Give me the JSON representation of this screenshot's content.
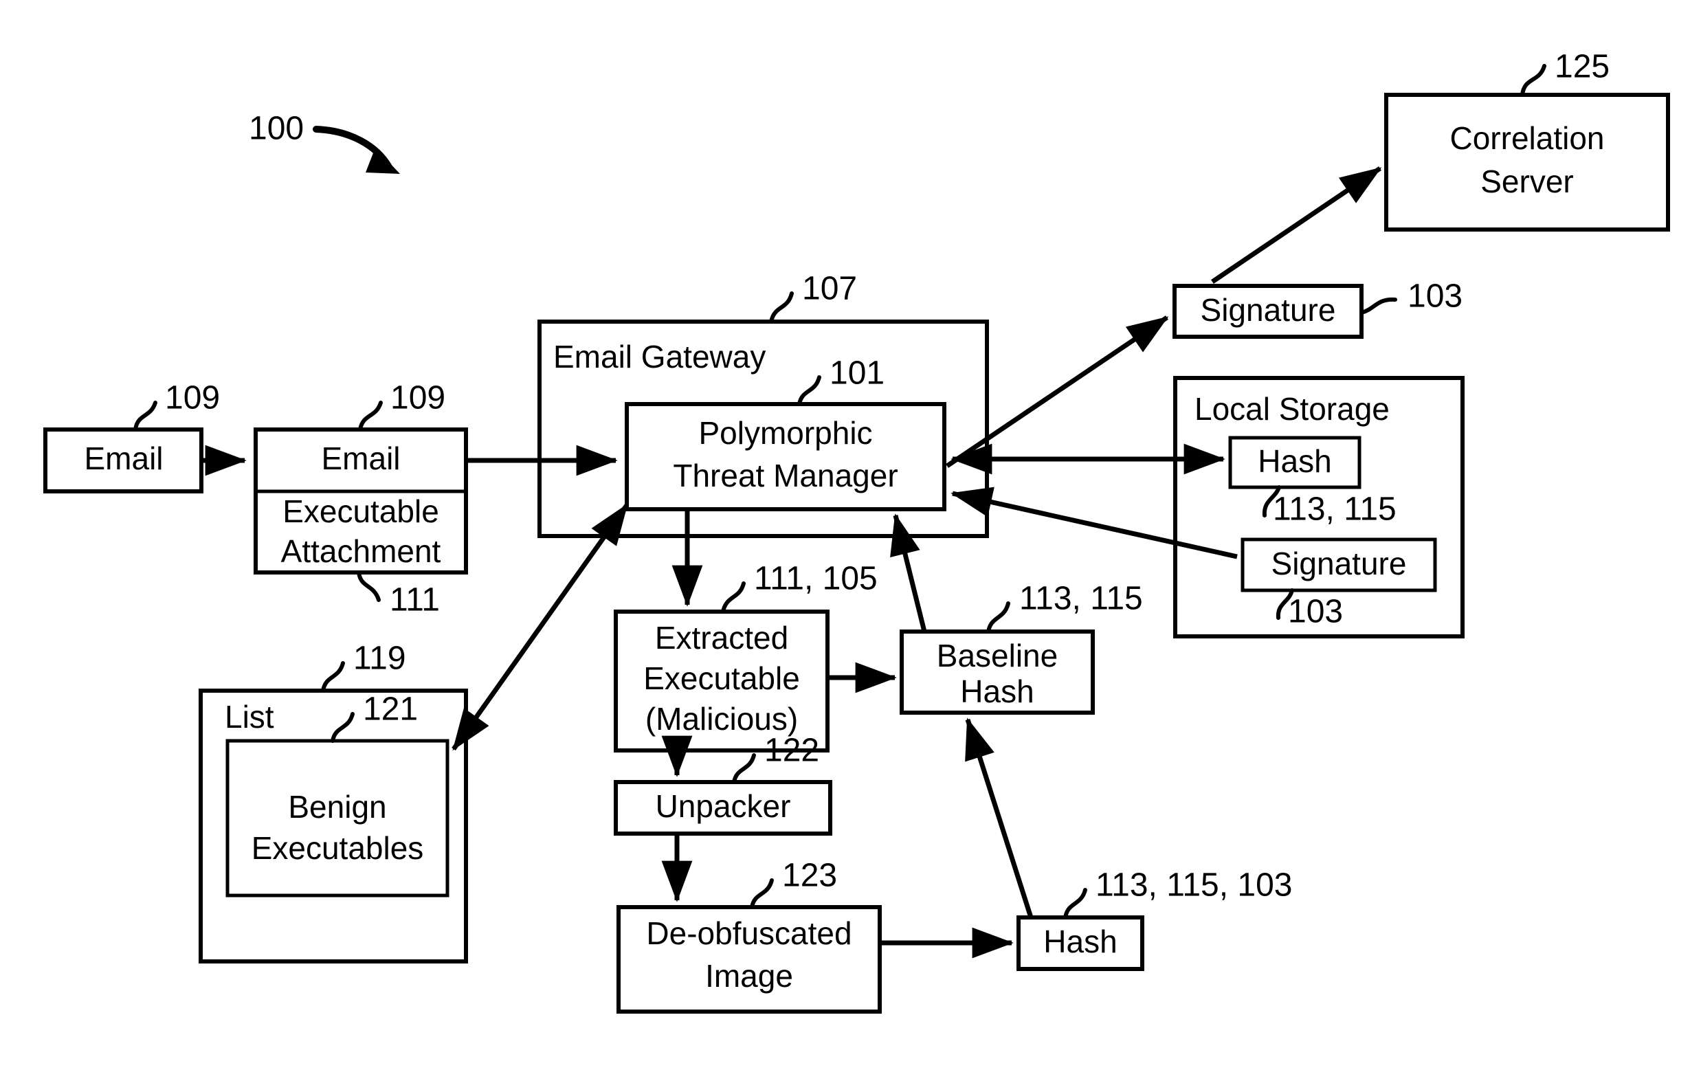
{
  "figure": {
    "number": "100",
    "type": "patent-block-diagram"
  },
  "boxes": {
    "email_source": {
      "label": "Email",
      "ref": "109"
    },
    "email_with_attachment": {
      "label_top": "Email",
      "label_bottom_line1": "Executable",
      "label_bottom_line2": "Attachment",
      "ref_top": "109",
      "ref_bottom": "111"
    },
    "email_gateway": {
      "label": "Email Gateway",
      "ref": "107"
    },
    "polymorphic_threat_manager": {
      "label_line1": "Polymorphic",
      "label_line2": "Threat Manager",
      "ref": "101"
    },
    "correlation_server": {
      "label_line1": "Correlation",
      "label_line2": "Server",
      "ref": "125"
    },
    "signature_out": {
      "label": "Signature",
      "ref": "103"
    },
    "local_storage": {
      "label": "Local Storage"
    },
    "local_storage_hash": {
      "label": "Hash",
      "ref": "113, 115"
    },
    "local_storage_signature": {
      "label": "Signature",
      "ref": "103"
    },
    "extracted_executable": {
      "label_line1": "Extracted",
      "label_line2": "Executable",
      "label_line3": "(Malicious)",
      "ref": "111, 105"
    },
    "baseline_hash": {
      "label_line1": "Baseline",
      "label_line2": "Hash",
      "ref": "113, 115"
    },
    "list": {
      "label": "List",
      "ref": "119"
    },
    "benign_executables": {
      "label_line1": "Benign",
      "label_line2": "Executables",
      "ref": "121"
    },
    "unpacker": {
      "label": "Unpacker",
      "ref": "122"
    },
    "deobfuscated_image": {
      "label_line1": "De-obfuscated",
      "label_line2": "Image",
      "ref": "123"
    },
    "hash_result": {
      "label": "Hash",
      "ref": "113, 115, 103"
    }
  },
  "colors": {
    "stroke": "#000000",
    "fill": "#ffffff",
    "background": "#ffffff"
  }
}
